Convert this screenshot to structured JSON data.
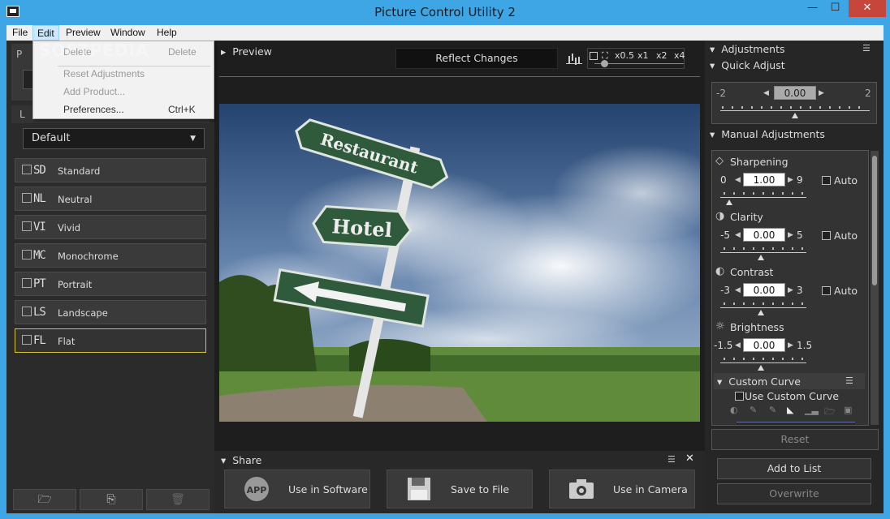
{
  "window": {
    "title": "Picture Control Utility 2",
    "minimize": "—",
    "maximize": "☐",
    "close": "✕"
  },
  "menu": [
    {
      "label": "File"
    },
    {
      "label": "Edit"
    },
    {
      "label": "Preview"
    },
    {
      "label": "Window"
    },
    {
      "label": "Help"
    }
  ],
  "edit_menu": {
    "delete": "Delete",
    "delete_shortcut": "Delete",
    "reset_adjustments": "Reset Adjustments",
    "add_product": "Add Product...",
    "preferences": "Preferences...",
    "preferences_shortcut": "Ctrl+K"
  },
  "watermark": "SOFTPEDIA",
  "left_panel": {
    "list_tab": "L",
    "top_tab": "P",
    "select_value": "Default",
    "presets": [
      {
        "code": "SD",
        "label": "Standard"
      },
      {
        "code": "NL",
        "label": "Neutral"
      },
      {
        "code": "VI",
        "label": "Vivid"
      },
      {
        "code": "MC",
        "label": "Monochrome"
      },
      {
        "code": "PT",
        "label": "Portrait"
      },
      {
        "code": "LS",
        "label": "Landscape"
      },
      {
        "code": "FL",
        "label": "Flat"
      }
    ],
    "selected_preset": 6,
    "bottom_icons": [
      "open-folder-icon",
      "import-file-icon",
      "trash-icon"
    ]
  },
  "preview": {
    "title": "Preview",
    "reflect_button": "Reflect Changes",
    "zoom_fit": "⛶",
    "zoom_levels": [
      "x0.5",
      "x1",
      "x2",
      "x4"
    ],
    "photo_signs": {
      "sign1": "Restaurant",
      "sign2": "Hotel"
    }
  },
  "share": {
    "title": "Share",
    "buttons": [
      {
        "label": "Use in Software",
        "icon": "app-icon",
        "icon_text": "APP"
      },
      {
        "label": "Save to File",
        "icon": "floppy-disk-icon"
      },
      {
        "label": "Use in Camera",
        "icon": "camera-icon"
      }
    ]
  },
  "adjustments": {
    "title": "Adjustments",
    "quick_adjust": {
      "title": "Quick Adjust",
      "min": "-2",
      "max": "2",
      "value": "0.00",
      "level": 0.5
    },
    "manual_title": "Manual Adjustments",
    "manual": [
      {
        "name": "Sharpening",
        "min": "0",
        "max": "9",
        "value": "1.00",
        "auto": "Auto",
        "icon": "sharpening-icon",
        "level": 0.111
      },
      {
        "name": "Clarity",
        "min": "-5",
        "max": "5",
        "value": "0.00",
        "auto": "Auto",
        "icon": "clarity-icon",
        "level": 0.5
      },
      {
        "name": "Contrast",
        "min": "-3",
        "max": "3",
        "value": "0.00",
        "auto": "Auto",
        "icon": "contrast-icon",
        "level": 0.5
      },
      {
        "name": "Brightness",
        "min": "-1.5",
        "max": "1.5",
        "value": "0.00",
        "icon": "brightness-icon",
        "level": 0.5
      }
    ],
    "custom_curve": {
      "title": "Custom Curve",
      "checkbox": "Use Custom Curve"
    },
    "reset": "Reset",
    "add_to_list": "Add to List",
    "overwrite": "Overwrite"
  }
}
